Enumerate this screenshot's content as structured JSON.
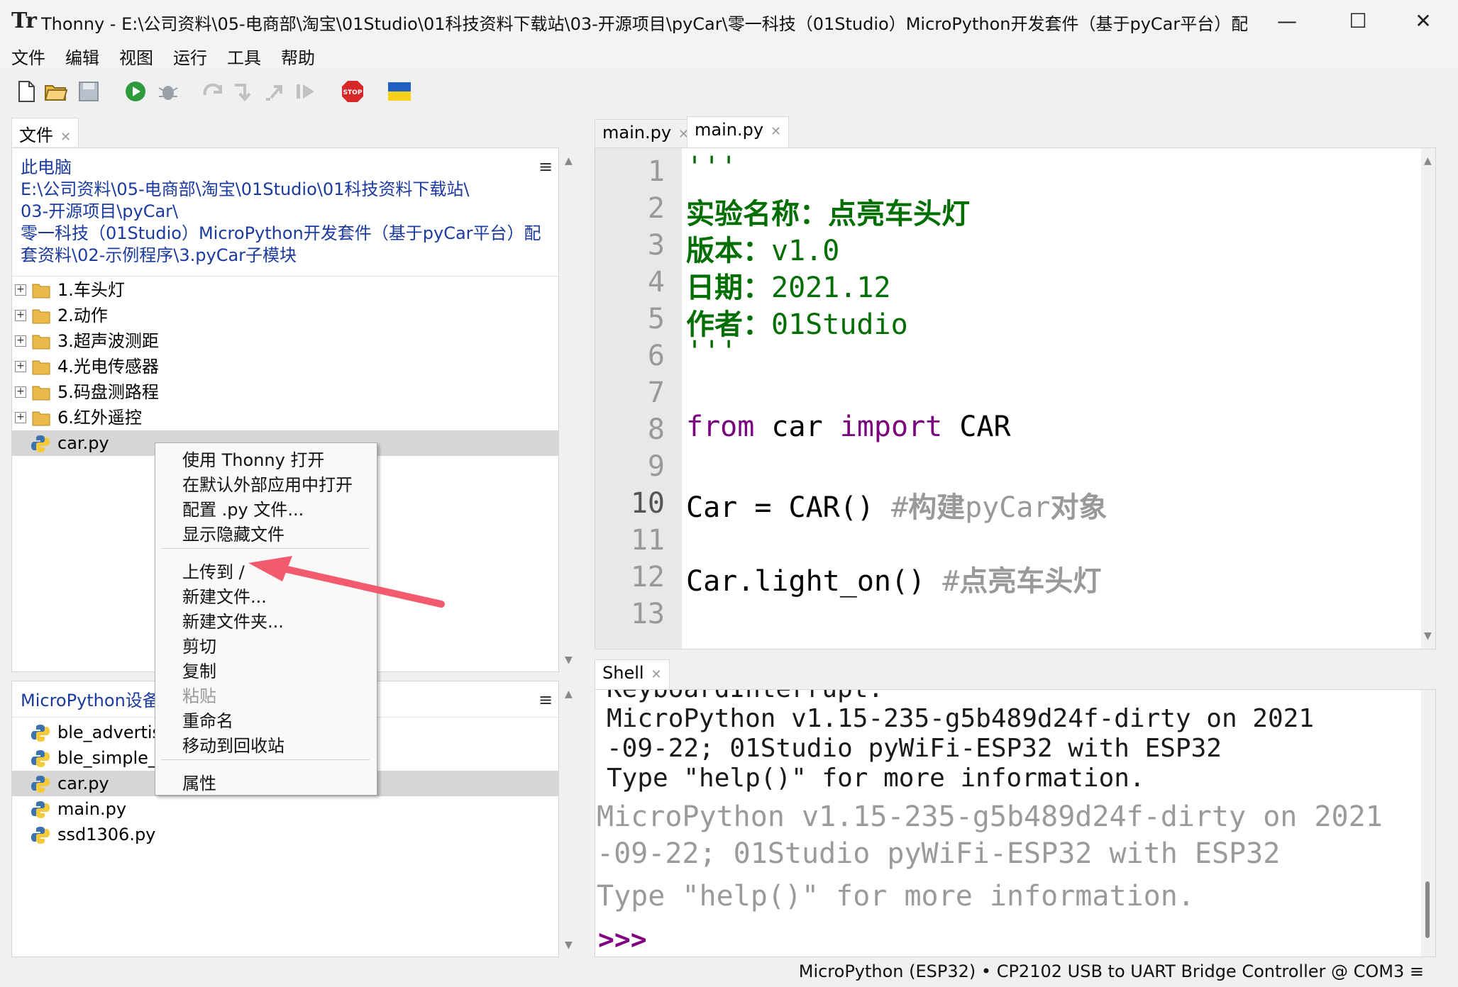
{
  "window": {
    "app_icon": "Tr",
    "title": "Thonny  -  E:\\公司资料\\05-电商部\\淘宝\\01Studio\\01科技资料下载站\\03-开源项目\\pyCar\\零一科技（01Studio）MicroPython开发套件（基于pyCar平台）配套资...",
    "minimize": "—",
    "maximize": "☐",
    "close": "✕"
  },
  "menu": [
    "文件",
    "编辑",
    "视图",
    "运行",
    "工具",
    "帮助"
  ],
  "files_panel": {
    "tab_label": "文件",
    "path": {
      "root": "此电脑",
      "line1": "E:\\公司资料\\05-电商部\\淘宝\\01Studio\\01科技资料下载站\\",
      "line2": "03-开源项目\\pyCar\\",
      "line3": "零一科技（01Studio）MicroPython开发套件（基于pyCar平台）配",
      "line4": "套资料\\02-示例程序\\3.pyCar子模块"
    },
    "folders": [
      "1.车头灯",
      "2.动作",
      "3.超声波测距",
      "4.光电传感器",
      "5.码盘测路程",
      "6.红外遥控"
    ],
    "file": "car.py"
  },
  "device_panel": {
    "title": "MicroPython设备",
    "files": [
      "ble_advertising.py",
      "ble_simple_peripheral.py",
      "car.py",
      "main.py",
      "ssd1306.py"
    ]
  },
  "context_menu": {
    "items": [
      "使用 Thonny 打开",
      "在默认外部应用中打开",
      "配置 .py 文件...",
      "显示隐藏文件",
      "上传到 /",
      "新建文件...",
      "新建文件夹...",
      "剪切",
      "复制",
      "粘贴",
      "重命名",
      "移动到回收站",
      "属性"
    ]
  },
  "editor": {
    "tabs": [
      "main.py",
      "main.py"
    ],
    "line_numbers": [
      "1",
      "2",
      "3",
      "4",
      "5",
      "6",
      "7",
      "8",
      "9",
      "10",
      "11",
      "12",
      "13"
    ],
    "code": {
      "l1": "'''",
      "l2": "实验名称：点亮车头灯",
      "l3_label": "版本：",
      "l3_value": "v1.0",
      "l4_label": "日期：",
      "l4_value": "2021.12",
      "l5_label": "作者：",
      "l5_value": "01Studio",
      "l6": "'''",
      "l8_kw1": "from",
      "l8_mod": " car ",
      "l8_kw2": "import",
      "l8_name": " CAR",
      "l10_code": "Car = CAR() ",
      "l10_hash": "#",
      "l10_comment": "构建",
      "l10_comment2": "pyCar",
      "l10_comment3": "对象",
      "l12_code": "Car.light_on() ",
      "l12_hash": "#",
      "l12_comment": "点亮车头灯"
    }
  },
  "shell": {
    "tab_label": "Shell",
    "cut_line": "KeyboardInterrupt:",
    "lines": [
      "MicroPython v1.15-235-g5b489d24f-dirty on 2021",
      "-09-22; 01Studio pyWiFi-ESP32 with ESP32",
      "Type \"help()\" for more information."
    ],
    "ghost_lines": [
      "MicroPython v1.15-235-g5b489d24f-dirty on 2021",
      "-09-22; 01Studio pyWiFi-ESP32 with ESP32",
      "Type \"help()\" for more information."
    ],
    "prompt": ">>>"
  },
  "status": {
    "text": "MicroPython (ESP32)  •  CP2102 USB to UART Bridge Controller @ COM3  ≡"
  },
  "colors": {
    "string": "#006e00",
    "keyword": "#7a0080",
    "comment": "#999999",
    "path_link": "#1a3aa0",
    "arrow": "#f25a6e"
  }
}
